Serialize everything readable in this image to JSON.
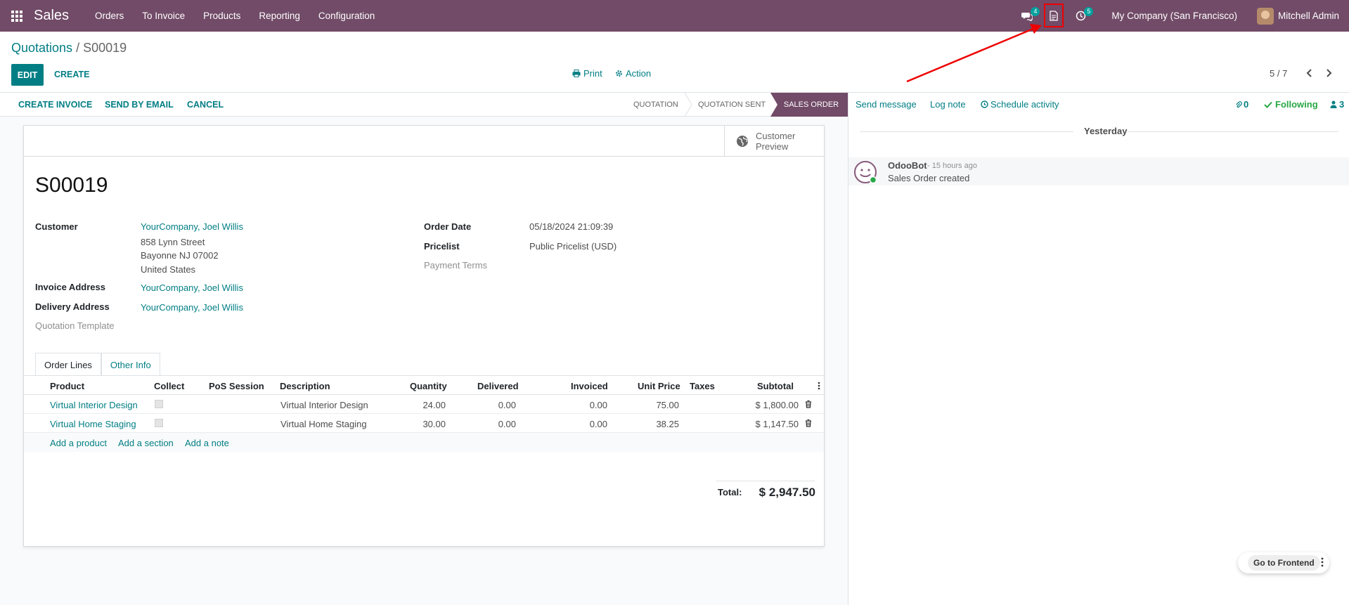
{
  "navbar": {
    "app_name": "Sales",
    "menu": [
      "Orders",
      "To Invoice",
      "Products",
      "Reporting",
      "Configuration"
    ],
    "messages_count": "4",
    "activities_count": "5",
    "company": "My Company (San Francisco)",
    "user": "Mitchell Admin"
  },
  "control": {
    "breadcrumb_parent": "Quotations",
    "breadcrumb_sep": " / ",
    "breadcrumb_current": "S00019",
    "edit_label": "EDIT",
    "create_label": "CREATE",
    "print_label": "Print",
    "action_label": "Action",
    "pager": "5 / 7"
  },
  "statusbar": {
    "buttons": [
      "CREATE INVOICE",
      "SEND BY EMAIL",
      "CANCEL"
    ],
    "stages": [
      "QUOTATION",
      "QUOTATION SENT",
      "SALES ORDER"
    ],
    "active_stage": "SALES ORDER"
  },
  "form": {
    "preview_line1": "Customer",
    "preview_line2": "Preview",
    "name": "S00019",
    "customer_label": "Customer",
    "customer": "YourCompany, Joel Willis",
    "address": [
      "858 Lynn Street",
      "Bayonne NJ 07002",
      "United States"
    ],
    "invoice_address_label": "Invoice Address",
    "invoice_address": "YourCompany, Joel Willis",
    "delivery_address_label": "Delivery Address",
    "delivery_address": "YourCompany, Joel Willis",
    "template_label": "Quotation Template",
    "order_date_label": "Order Date",
    "order_date": "05/18/2024 21:09:39",
    "pricelist_label": "Pricelist",
    "pricelist": "Public Pricelist (USD)",
    "payment_terms_label": "Payment Terms"
  },
  "tabs": [
    "Order Lines",
    "Other Info"
  ],
  "table": {
    "headers": [
      "Product",
      "Collect",
      "PoS Session",
      "Description",
      "Quantity",
      "Delivered",
      "Invoiced",
      "Unit Price",
      "Taxes",
      "Subtotal"
    ],
    "rows": [
      {
        "product": "Virtual Interior Design",
        "description": "Virtual Interior Design",
        "quantity": "24.00",
        "delivered": "0.00",
        "invoiced": "0.00",
        "unit_price": "75.00",
        "subtotal": "$ 1,800.00"
      },
      {
        "product": "Virtual Home Staging",
        "description": "Virtual Home Staging",
        "quantity": "30.00",
        "delivered": "0.00",
        "invoiced": "0.00",
        "unit_price": "38.25",
        "subtotal": "$ 1,147.50"
      }
    ],
    "add_links": [
      "Add a product",
      "Add a section",
      "Add a note"
    ],
    "total_label": "Total:",
    "total_value": "$ 2,947.50"
  },
  "chatter": {
    "send_message": "Send message",
    "log_note": "Log note",
    "schedule_activity": "Schedule activity",
    "attachments": "0",
    "following": "Following",
    "followers": "3",
    "date_separator": "Yesterday",
    "message_author": "OdooBot",
    "message_time": "- 15 hours ago",
    "message_body": "Sales Order created"
  },
  "frontend_button": "Go to Frontend",
  "colors": {
    "brand": "#714b67",
    "accent": "#017e84",
    "highlight": "#e00000"
  }
}
